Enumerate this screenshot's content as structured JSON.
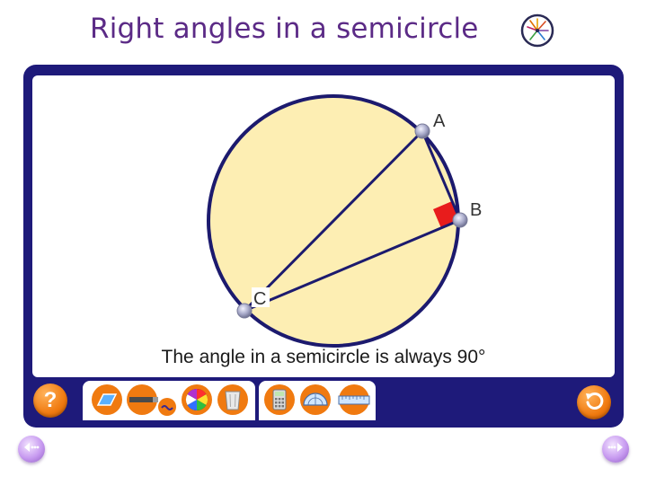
{
  "slide": {
    "title": "Right angles in a semicircle"
  },
  "diagram": {
    "points": [
      {
        "label": "A"
      },
      {
        "label": "B"
      },
      {
        "label": "C"
      }
    ],
    "caption": "The angle in a semicircle is always 90°",
    "colors": {
      "circle_fill": "#fdeeb3",
      "circle_stroke": "#1c1a6e",
      "right_angle_marker": "#e81c1c",
      "frame": "#1e1a7a"
    }
  },
  "toolbar": {
    "help_label": "?",
    "tools": [
      {
        "icon": "parallelogram-icon"
      },
      {
        "icon": "pencil-icon"
      },
      {
        "icon": "colour-wheel-icon"
      },
      {
        "icon": "bin-icon"
      },
      {
        "icon": "calculator-icon"
      },
      {
        "icon": "protractor-icon"
      },
      {
        "icon": "ruler-icon"
      }
    ],
    "undo_icon": "undo-icon"
  },
  "navigation": {
    "prev_icon": "previous-slide-icon",
    "next_icon": "next-slide-icon"
  },
  "accent": "#f07a10"
}
